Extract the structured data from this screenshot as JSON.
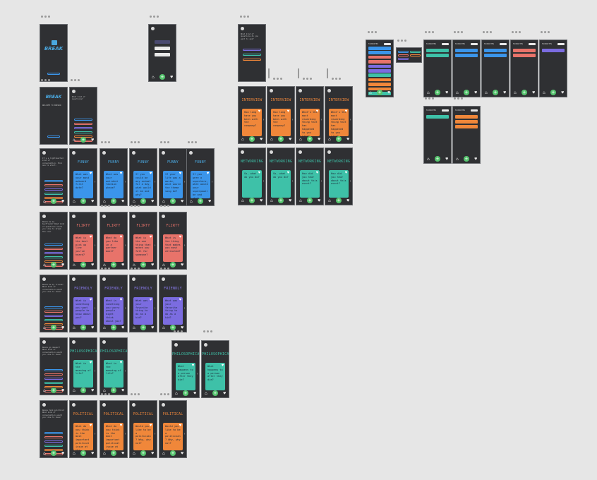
{
  "canvas": {
    "background": "#e6e6e6",
    "screen_bg": "#2f3033"
  },
  "colors": {
    "blue": "#3b95ea",
    "salmon": "#e8736a",
    "purple": "#7b6ce0",
    "teal": "#3ec1a8",
    "orange": "#f0873a",
    "title_blue": "#4aa8e0",
    "title_salmon": "#e8736a",
    "title_purple": "#8b7cf0",
    "title_teal": "#3ec1a8",
    "title_orange": "#f0873a",
    "fab_green": "#56c46e"
  },
  "icons": {
    "home": "⌂",
    "plus": "+",
    "heart": "♥",
    "arrow": "›"
  },
  "intro": {
    "logo": "BREAK",
    "welcome": "WELCOME TO BREAKR",
    "menu_prompt": "What kind of questions?",
    "pills": [
      "#3b95ea",
      "#e8736a",
      "#7b6ce0",
      "#3ec1a8",
      "#f0873a",
      "#e8736a"
    ]
  },
  "rows": [
    {
      "name": "FUNNY",
      "menu_text": "It's a lighthearted kind of conversation. Pick one to start.",
      "color": "blue",
      "questions": [
        "What was your most awkward first date?",
        "What was your weirdest fashion phase?",
        "If you could be any animal for a day, what would it be and why?",
        "If your life was a movie, what would the theme song be?",
        "If you were a superhero, what would your superpower be and why?"
      ]
    },
    {
      "name": "FLIRTY",
      "menu_text": "Wanna be my boyfriend? What kind of questions would you like to break the ice?",
      "color": "salmon",
      "questions": [
        "What is the best pick up line you've heard?",
        "What do you like in a partner most?",
        "What is the one thing that makes you fall for someone?",
        "What is the thing that makes you most attracted?"
      ]
    },
    {
      "name": "FRIENDLY",
      "menu_text": "Wanna be my friend? What kind of conversation would you like to have?",
      "color": "purple",
      "questions": [
        "What is something you want people to know about you?",
        "What is something you worry people might think about you?",
        "What was your favorite thing to do as a kid?",
        "What was your favorite thing to do as a kid?"
      ]
    },
    {
      "name": "PHILOSOPHICAL",
      "menu_text": "Wanna go deeper? What kind of conversation would you like to have?",
      "color": "teal",
      "questions": [
        "What is the meaning of life?",
        "What is the meaning of life?"
      ],
      "extra": [
        "What happens to a person after they die?",
        "What happens to a person after they die?"
      ]
    },
    {
      "name": "POLITICAL",
      "menu_text": "Wanna talk politics? What kind of conversation would you like to have?",
      "color": "orange",
      "questions": [
        "What do you think is the most important political issue at the moment?",
        "What do you think is the most important political issue at the moment?",
        "Would you like to be a politician? Why, why not?",
        "Would you like to be a politician? Why, why not?"
      ]
    }
  ],
  "interview": {
    "menu_text": "What kind of questions do you want to ask?",
    "menu_items": [
      "INTERVIEW",
      "NETWORKING",
      "DATING"
    ],
    "name": "INTERVIEW",
    "color": "orange",
    "questions": [
      "How long have you been with the company?",
      "How long have you been with the company?",
      "What's the most rewarding thing that has happened to you since joining the company?",
      "What's the most rewarding thing that has happened to you since joining the company?"
    ]
  },
  "networking": {
    "name": "NETWORKING",
    "color": "teal",
    "questions": [
      "So, what do you do?",
      "So, what do you do?",
      "How did you hear about this event?",
      "How did you hear about this event?"
    ]
  },
  "favorites": {
    "titles": [
      "FAVORITES",
      "FAVORITES",
      "FAVORITES",
      "FAVORITES",
      "FAVORITES",
      "FAVORITES"
    ],
    "second_titles": [
      "FAVORITES",
      "FAVORITES"
    ]
  },
  "signup": {
    "labels": [
      "Email",
      "Password",
      "Login"
    ]
  }
}
